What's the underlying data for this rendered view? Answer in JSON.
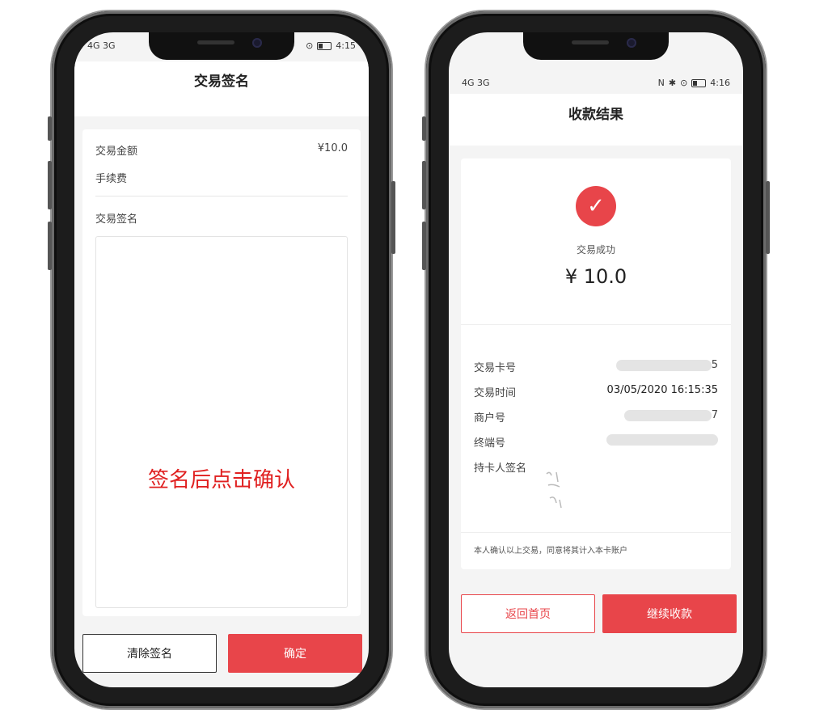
{
  "left_phone": {
    "status": {
      "left": "4G 3G",
      "time": "4:15"
    },
    "title": "交易签名",
    "amount_label": "交易金额",
    "amount_value": "¥10.0",
    "fee_label": "手续费",
    "signature_label": "交易签名",
    "annotation": "签名后点击确认",
    "clear_button": "清除签名",
    "confirm_button": "确定"
  },
  "right_phone": {
    "status": {
      "left": "4G 3G",
      "time": "4:16"
    },
    "title": "收款结果",
    "success_text": "交易成功",
    "amount": "¥ 10.0",
    "rows": [
      {
        "label": "交易卡号",
        "value": "5"
      },
      {
        "label": "交易时间",
        "value": "03/05/2020 16:15:35"
      },
      {
        "label": "商户号",
        "value": "7"
      },
      {
        "label": "终端号",
        "value": ""
      },
      {
        "label": "持卡人签名",
        "value": ""
      }
    ],
    "disclaimer": "本人确认以上交易，同意将其计入本卡账户",
    "home_button": "返回首页",
    "continue_button": "继续收款"
  },
  "colors": {
    "accent": "#e8454a",
    "annotation": "#e02020",
    "background": "#f4f4f4"
  }
}
